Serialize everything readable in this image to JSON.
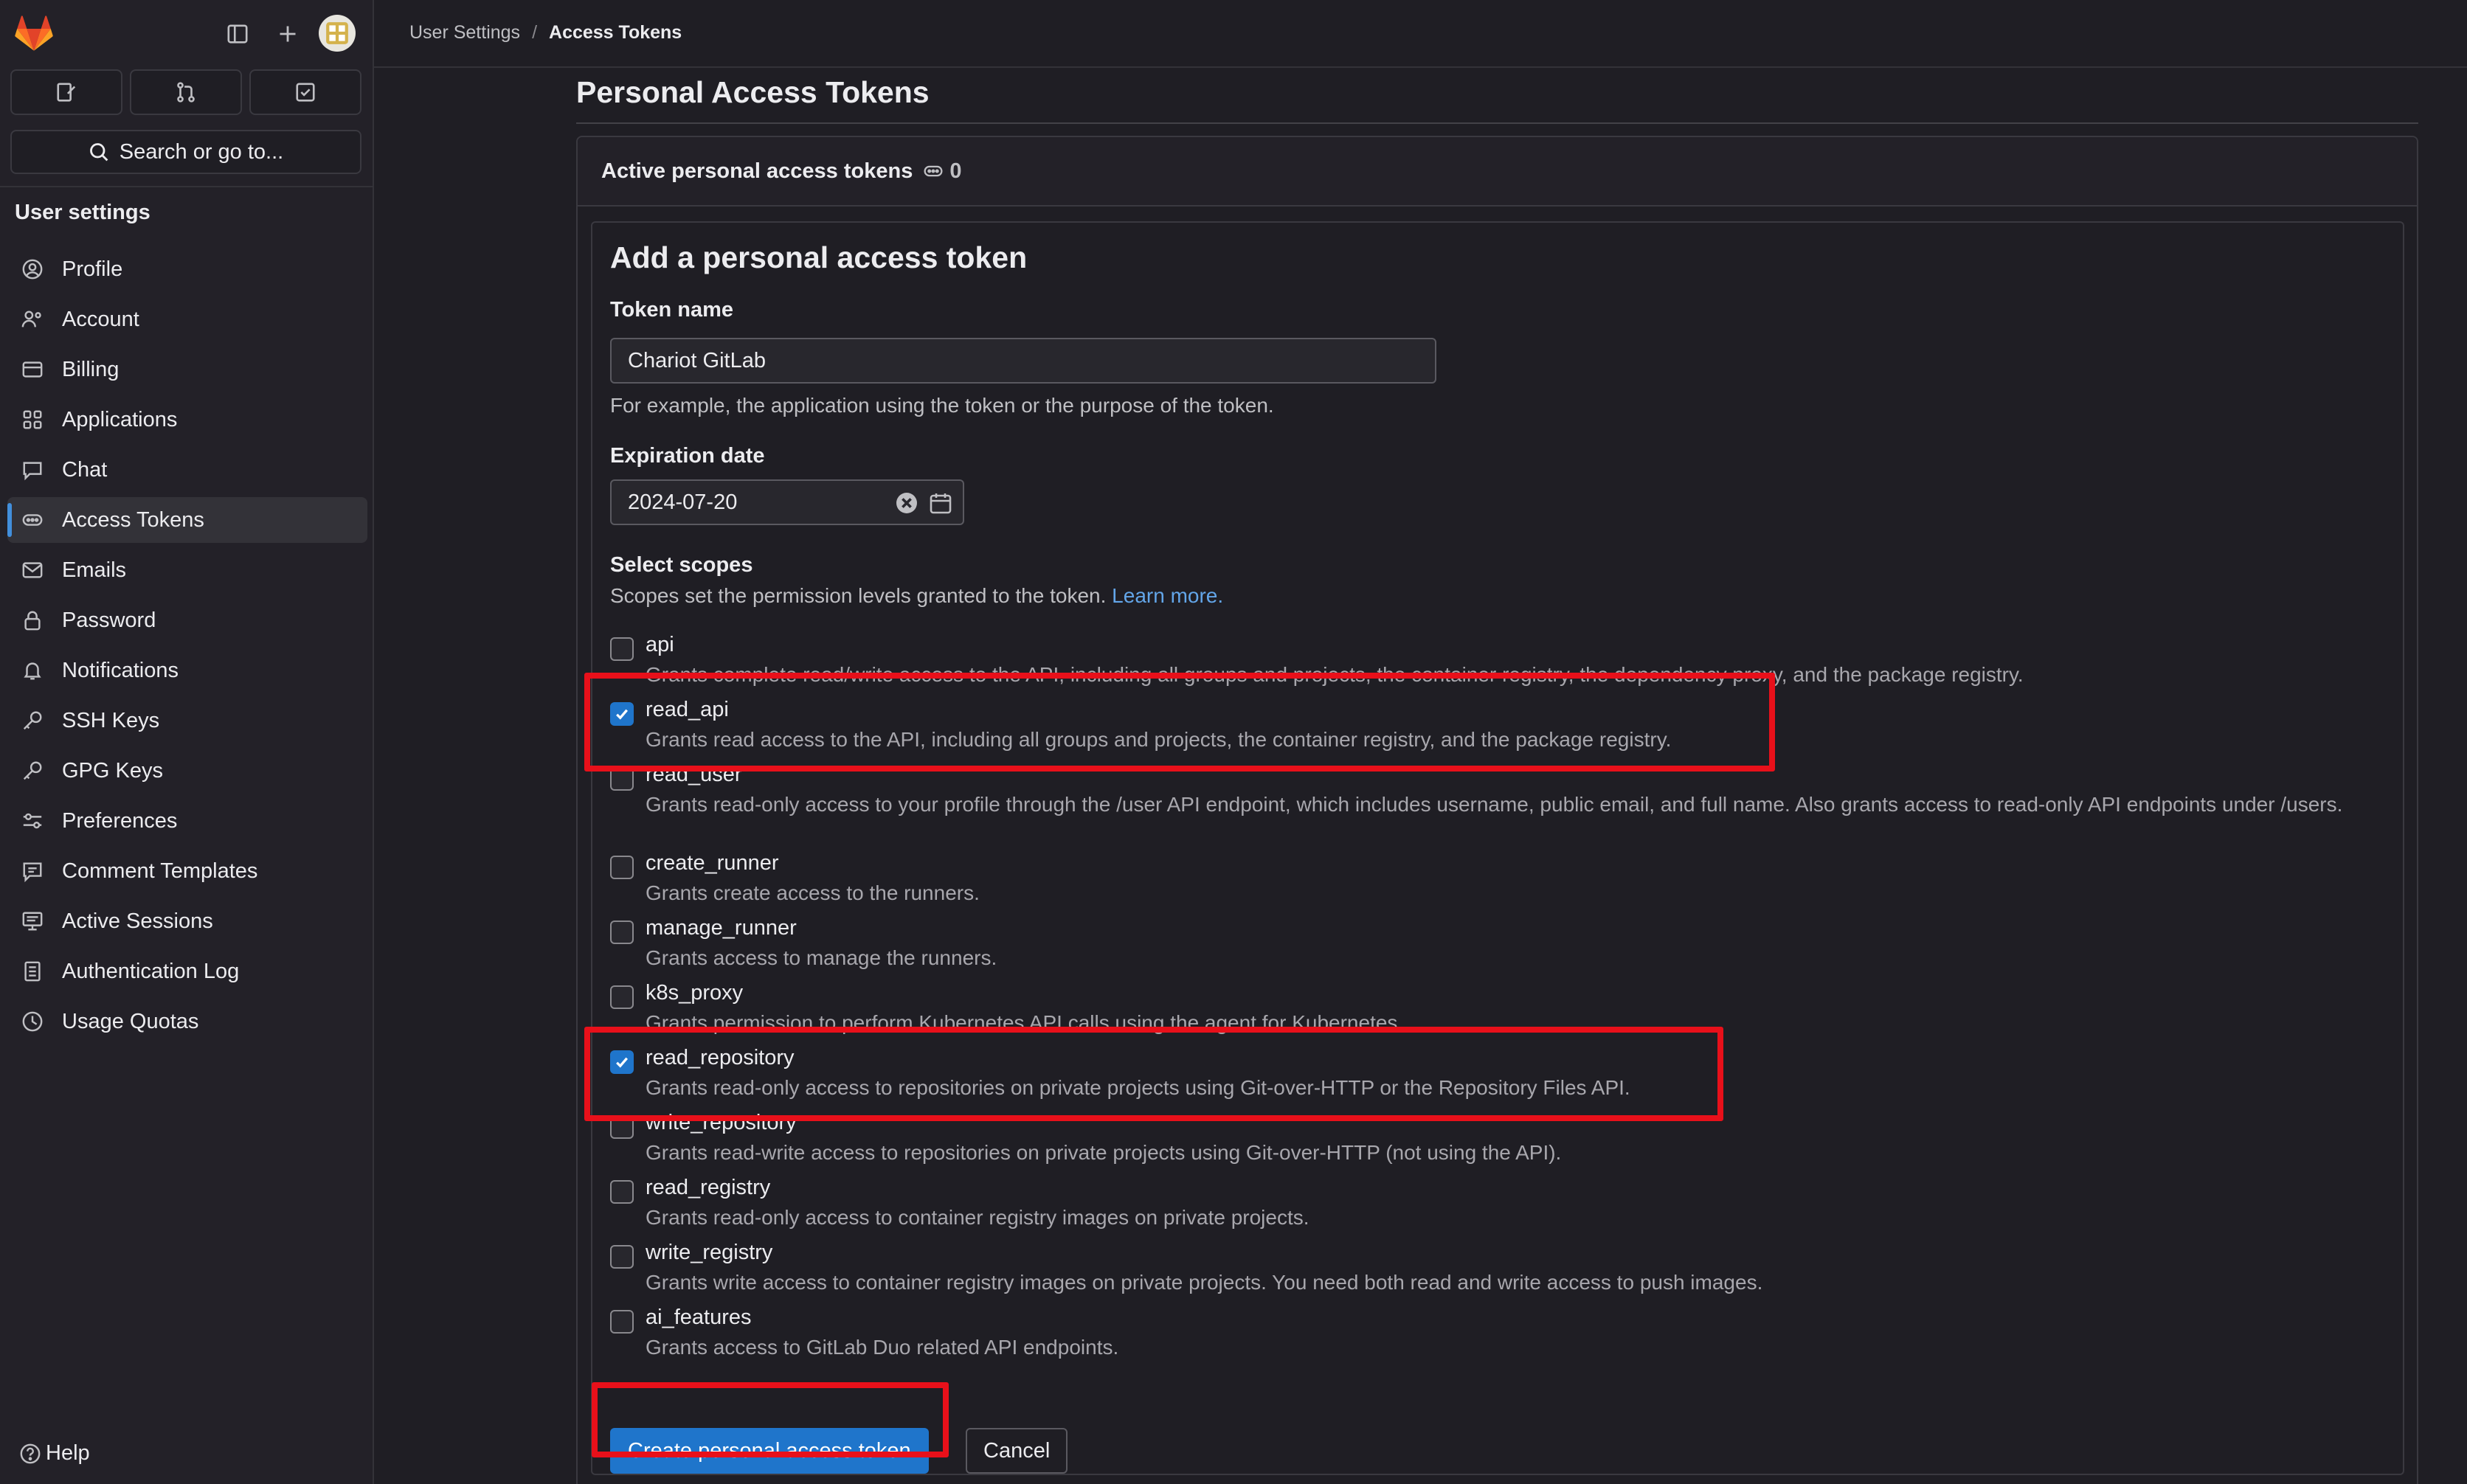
{
  "breadcrumb": {
    "parent": "User Settings",
    "separator": "/",
    "current": "Access Tokens"
  },
  "sidebar": {
    "search_label": "Search or go to...",
    "heading": "User settings",
    "items": [
      {
        "label": "Profile",
        "icon": "profile-icon"
      },
      {
        "label": "Account",
        "icon": "account-icon"
      },
      {
        "label": "Billing",
        "icon": "billing-icon"
      },
      {
        "label": "Applications",
        "icon": "applications-icon"
      },
      {
        "label": "Chat",
        "icon": "chat-icon"
      },
      {
        "label": "Access Tokens",
        "icon": "token-icon",
        "active": true
      },
      {
        "label": "Emails",
        "icon": "mail-icon"
      },
      {
        "label": "Password",
        "icon": "lock-icon"
      },
      {
        "label": "Notifications",
        "icon": "bell-icon"
      },
      {
        "label": "SSH Keys",
        "icon": "key-icon"
      },
      {
        "label": "GPG Keys",
        "icon": "key-icon"
      },
      {
        "label": "Preferences",
        "icon": "preferences-icon"
      },
      {
        "label": "Comment Templates",
        "icon": "comment-icon"
      },
      {
        "label": "Active Sessions",
        "icon": "monitor-icon"
      },
      {
        "label": "Authentication Log",
        "icon": "log-icon"
      },
      {
        "label": "Usage Quotas",
        "icon": "quota-icon"
      }
    ],
    "help_label": "Help"
  },
  "page": {
    "title": "Personal Access Tokens",
    "active_tokens_label": "Active personal access tokens",
    "active_tokens_count": "0"
  },
  "form": {
    "title": "Add a personal access token",
    "token_name_label": "Token name",
    "token_name_value": "Chariot GitLab",
    "token_name_help": "For example, the application using the token or the purpose of the token.",
    "expiration_label": "Expiration date",
    "expiration_value": "2024-07-20",
    "scopes_label": "Select scopes",
    "scopes_help": "Scopes set the permission levels granted to the token.",
    "learn_more": "Learn more.",
    "scopes": [
      {
        "name": "api",
        "checked": false,
        "desc": "Grants complete read/write access to the API, including all groups and projects, the container registry, the dependency proxy, and the package registry."
      },
      {
        "name": "read_api",
        "checked": true,
        "desc": "Grants read access to the API, including all groups and projects, the container registry, and the package registry."
      },
      {
        "name": "read_user",
        "checked": false,
        "desc": "Grants read-only access to your profile through the /user API endpoint, which includes username, public email, and full name. Also grants access to read-only API endpoints under /users."
      },
      {
        "name": "create_runner",
        "checked": false,
        "desc": "Grants create access to the runners."
      },
      {
        "name": "manage_runner",
        "checked": false,
        "desc": "Grants access to manage the runners."
      },
      {
        "name": "k8s_proxy",
        "checked": false,
        "desc": "Grants permission to perform Kubernetes API calls using the agent for Kubernetes."
      },
      {
        "name": "read_repository",
        "checked": true,
        "desc": "Grants read-only access to repositories on private projects using Git-over-HTTP or the Repository Files API."
      },
      {
        "name": "write_repository",
        "checked": false,
        "desc": "Grants read-write access to repositories on private projects using Git-over-HTTP (not using the API)."
      },
      {
        "name": "read_registry",
        "checked": false,
        "desc": "Grants read-only access to container registry images on private projects."
      },
      {
        "name": "write_registry",
        "checked": false,
        "desc": "Grants write access to container registry images on private projects. You need both read and write access to push images."
      },
      {
        "name": "ai_features",
        "checked": false,
        "desc": "Grants access to GitLab Duo related API endpoints."
      }
    ],
    "create_button": "Create personal access token",
    "cancel_button": "Cancel"
  },
  "colors": {
    "accent": "#1f75cb",
    "annotation": "#e8101a",
    "background": "#1f1e24"
  }
}
